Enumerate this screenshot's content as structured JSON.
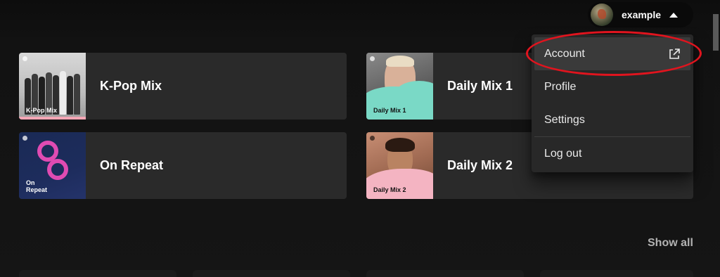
{
  "user": {
    "name": "example"
  },
  "cards": [
    {
      "title": "K-Pop Mix",
      "cover_label": "K-Pop Mix"
    },
    {
      "title": "Daily Mix 1",
      "cover_label": "Daily Mix 1"
    },
    {
      "title": "On Repeat",
      "cover_label": "On\nRepeat"
    },
    {
      "title": "Daily Mix 2",
      "cover_label": "Daily Mix 2"
    }
  ],
  "menu": {
    "items": [
      {
        "label": "Account",
        "icon": "external-link-icon"
      },
      {
        "label": "Profile"
      },
      {
        "label": "Settings"
      },
      {
        "label": "Log out"
      }
    ]
  },
  "section": {
    "show_all_label": "Show all"
  },
  "colors": {
    "background": "#121212",
    "card": "#2a2a2a",
    "menu": "#282828",
    "highlight": "#e0141e",
    "accent_pink": "#e04bb2",
    "accent_teal": "#7ad9c6"
  }
}
